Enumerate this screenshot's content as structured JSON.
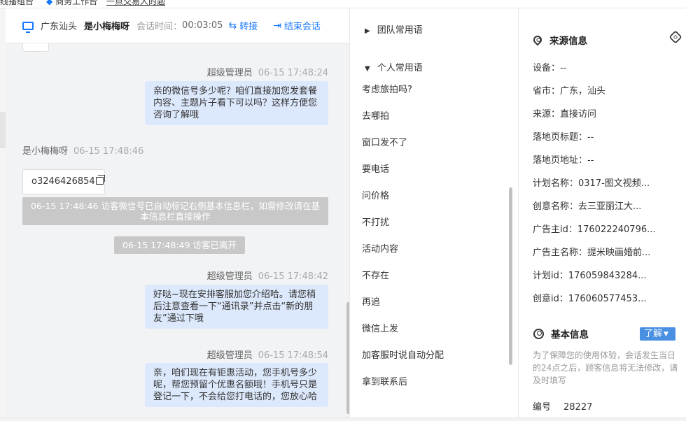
{
  "topbar": {
    "tab1": "线播组台",
    "tab2": "商务工作台",
    "tab3": "一点交易人的题"
  },
  "header": {
    "location": "广东汕头",
    "visitor_name": "是小梅梅呀",
    "time_label": "会话时间：",
    "time_value": "00:03:05",
    "transfer_label": "转接",
    "end_label": "结束会话"
  },
  "messages": {
    "m1_sender": "超级管理员",
    "m1_time": "06-15 17:48:24",
    "m1_text": "亲的微信号多少呢？咱们直接加您发套餐内容、主题片子看下可以吗？这样方便您咨询了解哦",
    "m2_sender": "是小梅梅呀",
    "m2_time": "06-15 17:48:46",
    "m2_code": "o3246426854",
    "sys1": "06-15 17:48:46 访客微信号已自动标记右侧基本信息栏，如需修改请在基本信息栏直接操作",
    "sys2": "06-15 17:48:49 访客已离开",
    "m3_sender": "超级管理员",
    "m3_time": "06-15 17:48:42",
    "m3_text": "好哒~现在安排客服加您介绍哈。请您稍后注意查看一下“通讯录”并点击“新的朋友”通过下哦",
    "m4_sender": "超级管理员",
    "m4_time": "06-15 17:48:54",
    "m4_text": "亲，咱们现在有钜惠活动，您手机号多少呢，帮您预留个优惠名额哦！手机号只是登记一下，不会给您打电话的，您放心哈"
  },
  "phrases": {
    "team_group": "团队常用语",
    "personal_group": "个人常用语",
    "items": [
      "考虑旅拍吗?",
      "去哪拍",
      "窗口发不了",
      "要电话",
      "问价格",
      "不打扰",
      "活动内容",
      "不存在",
      "再追",
      "微信上发",
      "加客服时说自动分配",
      "拿到联系后"
    ]
  },
  "info": {
    "source_title": "来源信息",
    "device": "设备：--",
    "province": "省市：广东，汕头",
    "source": "来源：直接访问",
    "landing_title": "落地页标题：--",
    "landing_url": "落地页地址：--",
    "plan_name": "计划名称：0317-图文视频...",
    "creative_name": "创意名称：去三亚丽江大...",
    "advertiser_id": "广告主id：176022240796...",
    "advertiser_name": "广告主名称：提米映画婚前...",
    "plan_id": "计划id：176059843284...",
    "creative_id": "创意id：176060577453...",
    "basic_title": "基本信息",
    "understand_label": "了解",
    "notice": "为了保障您的使用体验，会话发生当日的24点之后，顾客信息将无法修改，请及时填写",
    "code_label": "编号",
    "code_value": "28227"
  },
  "colors": {
    "accent": "#1677ff",
    "bubble": "#dce8fb",
    "system_note": "#c8c8c8",
    "understand_btn": "#4a90e2"
  }
}
